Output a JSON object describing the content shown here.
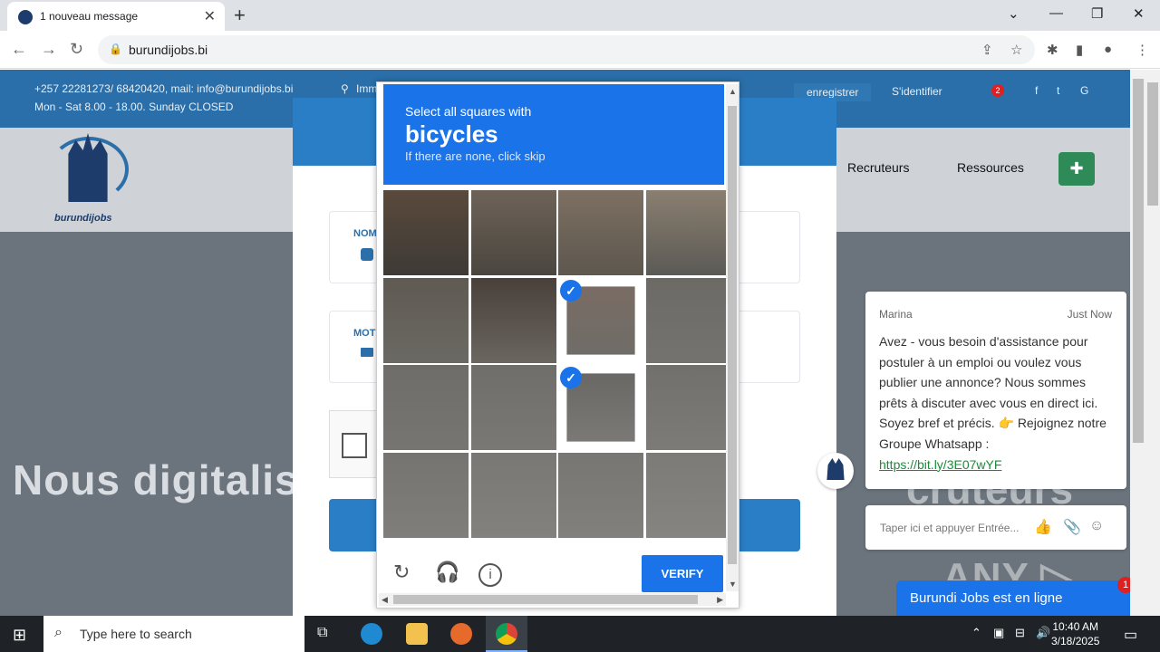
{
  "browser": {
    "tab_title": "1 nouveau message",
    "url": "burundijobs.bi",
    "new_tab_symbol": "+",
    "tab_close_symbol": "✕",
    "window_controls": {
      "tab_list": "⌄",
      "minimize": "—",
      "restore": "❐",
      "close": "✕"
    }
  },
  "site": {
    "contact": "+257 22281273/ 68420420, mail: info@burundijobs.bi",
    "address_partial": "Imm",
    "hours": "Mon - Sat 8.00 - 18.00. Sunday CLOSED",
    "register": "enregistrer",
    "login": "S'identifier",
    "notif_count": "2",
    "logo_name": "burundijobs",
    "nav": [
      "Recruteurs",
      "Ressources"
    ],
    "hero_text": "Nous digitalis",
    "hero_trail": "cruteurs"
  },
  "login_form": {
    "username_label": "NOM",
    "password_label": "MOT"
  },
  "captcha": {
    "prompt": "Select all squares with",
    "target": "bicycles",
    "hint": "If there are none, click skip",
    "verify_label": "VERIFY",
    "selected_cells": [
      6,
      10
    ],
    "icons": {
      "refresh": "refresh-icon",
      "audio": "headphones-icon",
      "info": "info-icon"
    }
  },
  "chat": {
    "agent": "Marina",
    "time": "Just Now",
    "message": "Avez - vous besoin d'assistance pour postuler à un emploi ou voulez vous publier une annonce? Nous sommes prêts à discuter avec vous en direct ici. Soyez bref et précis. 👉 Rejoignez notre Groupe Whatsapp :",
    "link": "https://bit.ly/3E07wYF",
    "input_placeholder": "Taper ici et appuyer Entrée...",
    "status_bar": "Burundi Jobs est en ligne",
    "badge": "1"
  },
  "watermark": "ANY ▷ RUN",
  "taskbar": {
    "search_placeholder": "Type here to search",
    "time": "10:40 AM",
    "date": "3/18/2025"
  }
}
